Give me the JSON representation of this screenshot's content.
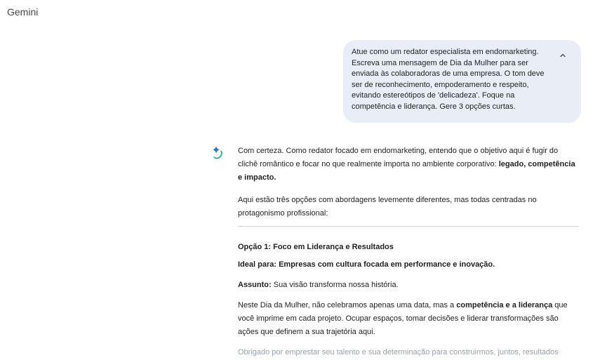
{
  "app": {
    "title": "Gemini"
  },
  "user_message": {
    "text": "Atue como um redator especialista em endomarketing. Escreva uma mensagem de Dia da Mulher para ser enviada às colaboradoras de uma empresa. O tom deve ser de reconhecimento, empoderamento e respeito, evitando estereótipos de 'delicadeza'. Foque na competência e liderança. Gere 3 opções curtas.",
    "collapse_icon": "chevron-up-icon"
  },
  "response": {
    "avatar_icon": "gemini-sparkle-icon",
    "intro_text": "Com certeza. Como redator focado em endomarketing, entendo que o objetivo aqui é fugir do clichê romântico e focar no que realmente importa no ambiente corporativo: ",
    "intro_bold": "legado, competência e impacto.",
    "options_intro": "Aqui estão três opções com abordagens levemente diferentes, mas todas centradas no protagonismo profissional:",
    "option1": {
      "heading": "Opção 1: Foco em Liderança e Resultados",
      "ideal": "Ideal para: Empresas com cultura focada em performance e inovação.",
      "subject_label": "Assunto:",
      "subject_text": " Sua visão transforma nossa história.",
      "body_part1": "Neste Dia da Mulher, não celebramos apenas uma data, mas a ",
      "body_bold": "competência e a liderança",
      "body_part2": " que você imprime em cada projeto. Ocupar espaços, tomar decisões e liderar transformações são ações que definem a sua trajetória aqui.",
      "faded_line": "Obrigado por emprestar seu talento e sua determinação para construirmos, juntos, resultados"
    }
  }
}
